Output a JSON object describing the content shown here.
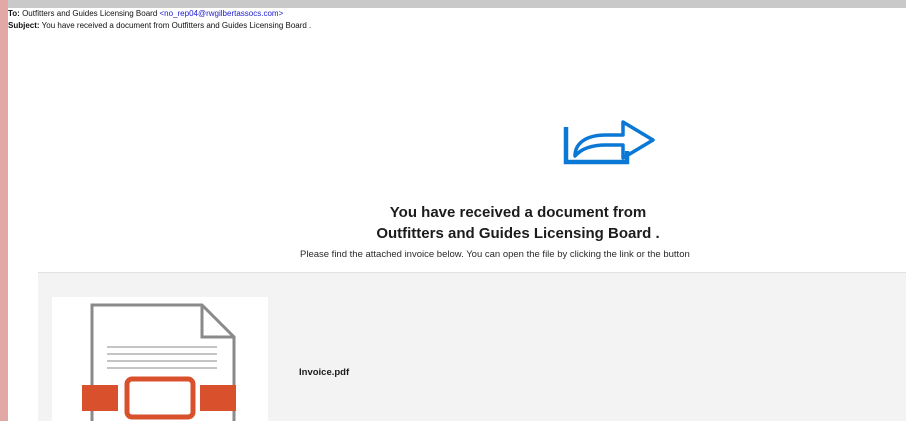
{
  "email": {
    "to_label": "To:",
    "to_name": "Outfitters and Guides Licensing Board",
    "to_address": "<no_rep04@rwgilbertassocs.com>",
    "subject_label": "Subject:",
    "subject_text": "You have received a document from Outfitters and Guides Licensing Board ."
  },
  "body": {
    "headline_line1": "You have received a document from",
    "headline_line2": "Outfitters and Guides Licensing Board .",
    "description": "Please find the attached invoice below. You can open the file by clicking the link or the button"
  },
  "attachment": {
    "file_name": "Invoice.pdf",
    "icon": "document-icon"
  },
  "icons": {
    "share": "share-arrow-icon"
  },
  "colors": {
    "share_icon": "#0a78d4",
    "document_accent": "#d9502c",
    "link": "#1a1acc"
  }
}
